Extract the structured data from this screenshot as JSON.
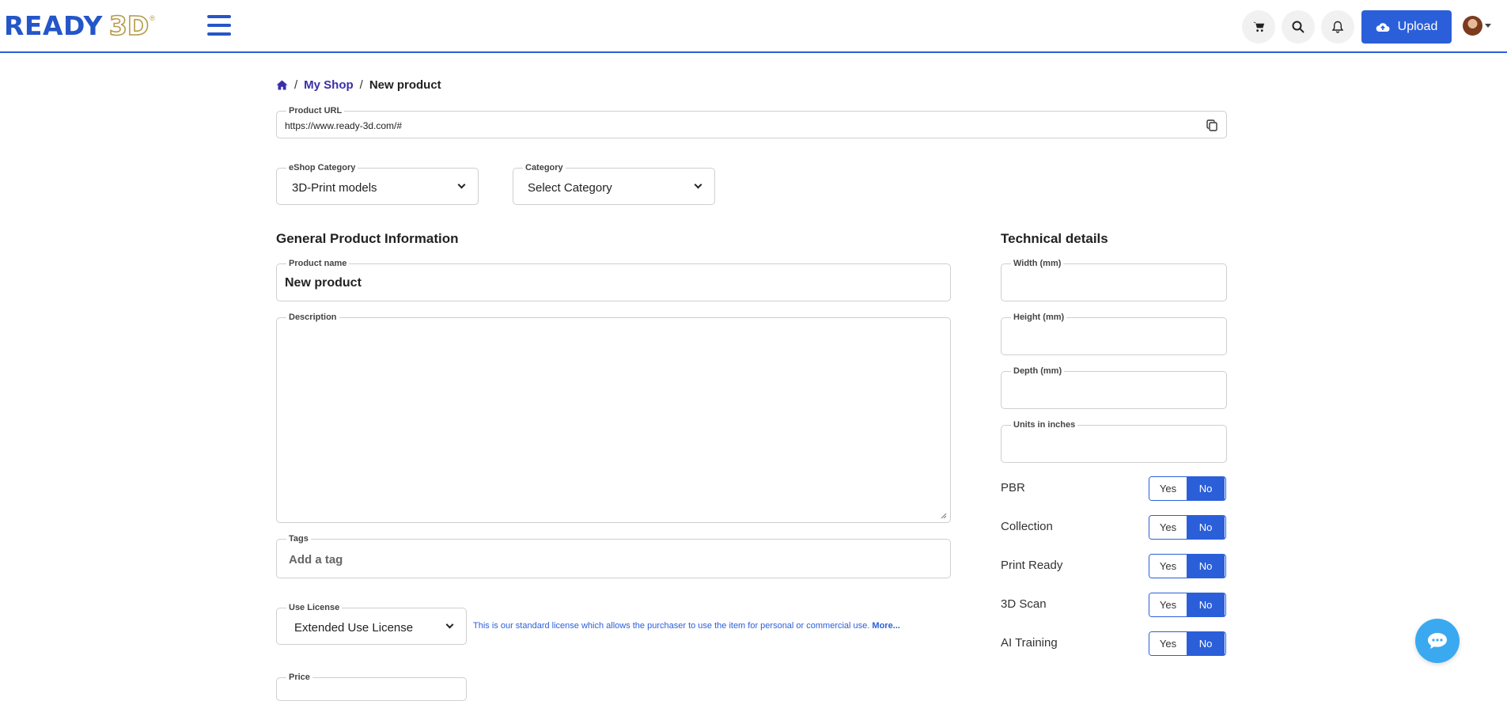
{
  "header": {
    "logo_main": "READY",
    "logo_3d": "3D",
    "logo_reg": "®",
    "upload_label": "Upload",
    "icons": [
      "cart-icon",
      "search-icon",
      "bell-icon",
      "cloud-upload-icon"
    ],
    "accent_color": "#2b5fd9"
  },
  "breadcrumb": {
    "home_icon": "home-icon",
    "sep": "/",
    "shop": "My Shop",
    "current": "New product"
  },
  "product_url": {
    "label": "Product URL",
    "value": "https://www.ready-3d.com/#"
  },
  "eshop_category": {
    "label": "eShop Category",
    "value": "3D-Print models"
  },
  "category": {
    "label": "Category",
    "value": "Select Category"
  },
  "general": {
    "title": "General Product Information",
    "product_name_label": "Product name",
    "product_name_value": "New product",
    "description_label": "Description",
    "description_value": "",
    "tags_label": "Tags",
    "tags_placeholder": "Add a tag",
    "license_label": "Use License",
    "license_value": "Extended Use License",
    "license_note": "This is our standard license which allows the purchaser to use the item for personal or commercial use.",
    "license_more": "More...",
    "price_label": "Price"
  },
  "technical": {
    "title": "Technical details",
    "width_label": "Width (mm)",
    "height_label": "Height (mm)",
    "depth_label": "Depth (mm)",
    "units_label": "Units in inches",
    "toggles": [
      {
        "label": "PBR",
        "yes": "Yes",
        "no": "No",
        "selected": "No"
      },
      {
        "label": "Collection",
        "yes": "Yes",
        "no": "No",
        "selected": "No"
      },
      {
        "label": "Print Ready",
        "yes": "Yes",
        "no": "No",
        "selected": "No"
      },
      {
        "label": "3D Scan",
        "yes": "Yes",
        "no": "No",
        "selected": "No"
      },
      {
        "label": "AI Training",
        "yes": "Yes",
        "no": "No",
        "selected": "No"
      }
    ]
  },
  "chat": {
    "icon": "chat-bubble-icon"
  }
}
